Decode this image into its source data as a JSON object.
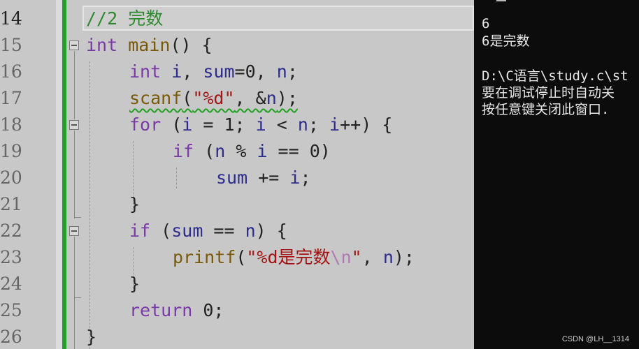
{
  "editor": {
    "line_numbers": [
      "14",
      "15",
      "16",
      "17",
      "18",
      "19",
      "20",
      "21",
      "22",
      "23",
      "24",
      "25",
      "26"
    ],
    "lines": {
      "l14": {
        "comment": "//2 完数"
      },
      "l15": {
        "kw": "int",
        "fn": "main",
        "rest": "() {"
      },
      "l16": {
        "kw": "int",
        "v1": "i",
        "p1": ", ",
        "v2": "sum",
        "p2": "=0, ",
        "v3": "n",
        "p3": ";"
      },
      "l17": {
        "fn": "scanf",
        "p1": "(",
        "str": "\"%d\"",
        "p2": ", &",
        "v": "n",
        "p3": ");"
      },
      "l18": {
        "kw": "for",
        "p1": " (",
        "v1": "i",
        "p2": " = 1; ",
        "v2": "i",
        "p3": " < ",
        "v3": "n",
        "p4": "; ",
        "v4": "i",
        "p5": "++) {"
      },
      "l19": {
        "kw": "if",
        "p1": " (",
        "v1": "n",
        "p2": " % ",
        "v2": "i",
        "p3": " == 0)"
      },
      "l20": {
        "v1": "sum",
        "p1": " += ",
        "v2": "i",
        "p2": ";"
      },
      "l21": {
        "p": "}"
      },
      "l22": {
        "kw": "if",
        "p1": " (",
        "v1": "sum",
        "p2": " == ",
        "v2": "n",
        "p3": ") {"
      },
      "l23": {
        "fn": "printf",
        "p1": "(",
        "str": "\"%d是完数",
        "esc": "\\n",
        "str2": "\"",
        "p2": ", ",
        "v": "n",
        "p3": ");"
      },
      "l24": {
        "p": "}"
      },
      "l25": {
        "kw": "return",
        "p1": " 0;"
      },
      "l26": {
        "p": "}"
      }
    }
  },
  "console": {
    "lines": [
      "6",
      "6是完数",
      "",
      "D:\\C语言\\study.c\\st",
      "要在调试停止时自动关",
      "按任意键关闭此窗口."
    ]
  },
  "watermark": "CSDN @LH__1314"
}
